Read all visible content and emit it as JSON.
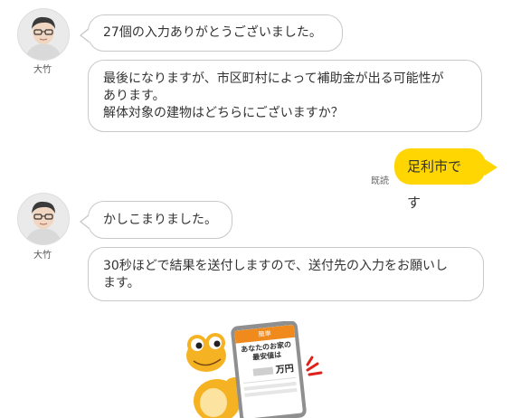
{
  "chat": {
    "agent_name": "大竹",
    "messages_group1": [
      "27個の入力ありがとうございました。",
      "最後になりますが、市区町村によって補助金が出る可能性が\nあります。\n解体対象の建物はどちらにございますか？"
    ],
    "user_reply": "足利市です",
    "read_status": "既読",
    "messages_group2": [
      "かしこまりました。",
      "30秒ほどで結果を送付しますので、送付先の入力をお願いし\nます。"
    ]
  },
  "promo": {
    "card_header": "簡単",
    "card_title_line1": "あなたのお家の",
    "card_title_line2": "最安値は",
    "card_price_unit": "万円"
  },
  "colors": {
    "user_bubble": "#ffd602",
    "bubble_border": "#c8c8c8",
    "frog": "#f5b324"
  }
}
